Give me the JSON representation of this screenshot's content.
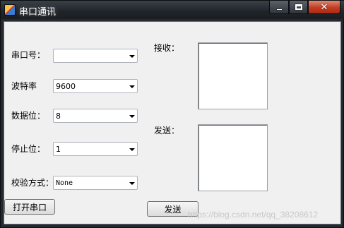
{
  "window": {
    "title": "串口通讯"
  },
  "caption_buttons": {
    "close_glyph": "✕"
  },
  "form": {
    "port": {
      "label": "串口号：",
      "value": ""
    },
    "baud": {
      "label": "波特率",
      "value": "9600"
    },
    "databits": {
      "label": "数据位：",
      "value": "8"
    },
    "stopbits": {
      "label": "停止位：",
      "value": "1"
    },
    "parity": {
      "label": "校验方式：",
      "value": "None"
    }
  },
  "receive": {
    "label": "接收："
  },
  "send": {
    "label": "发送："
  },
  "buttons": {
    "open_port": "打开串口",
    "send": "发送"
  },
  "watermark": "https://blog.csdn.net/qq_38208612"
}
